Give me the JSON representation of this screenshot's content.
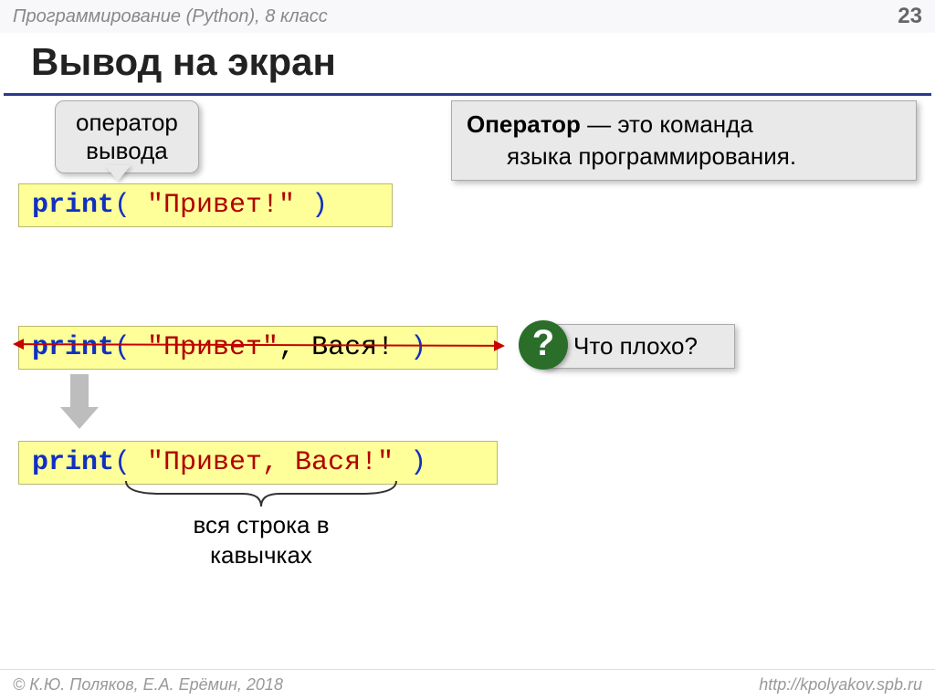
{
  "header": {
    "left": "Программирование (Python), 8 класс",
    "pageNumber": "23"
  },
  "title": "Вывод на экран",
  "callout1": {
    "line1": "оператор",
    "line2": "вывода"
  },
  "definition": {
    "term": "Оператор",
    "rest1": " — это команда",
    "rest2": "языка программирования."
  },
  "code1": {
    "kw": "print",
    "open": "( ",
    "str": "\"Привет!\"",
    "close": " )"
  },
  "code2": {
    "kw": "print",
    "open": "( ",
    "str": "\"Привет\"",
    "plain": ", Вася!",
    "close": " )"
  },
  "code3": {
    "kw": "print",
    "open": "( ",
    "str": "\"Привет, Вася!\"",
    "close": " )"
  },
  "question": {
    "mark": "?",
    "text": "Что плохо?"
  },
  "braceLabel": {
    "line1": "вся строка в",
    "line2": "кавычках"
  },
  "footer": {
    "left": "© К.Ю. Поляков, Е.А. Ерёмин, 2018",
    "right": "http://kpolyakov.spb.ru"
  }
}
